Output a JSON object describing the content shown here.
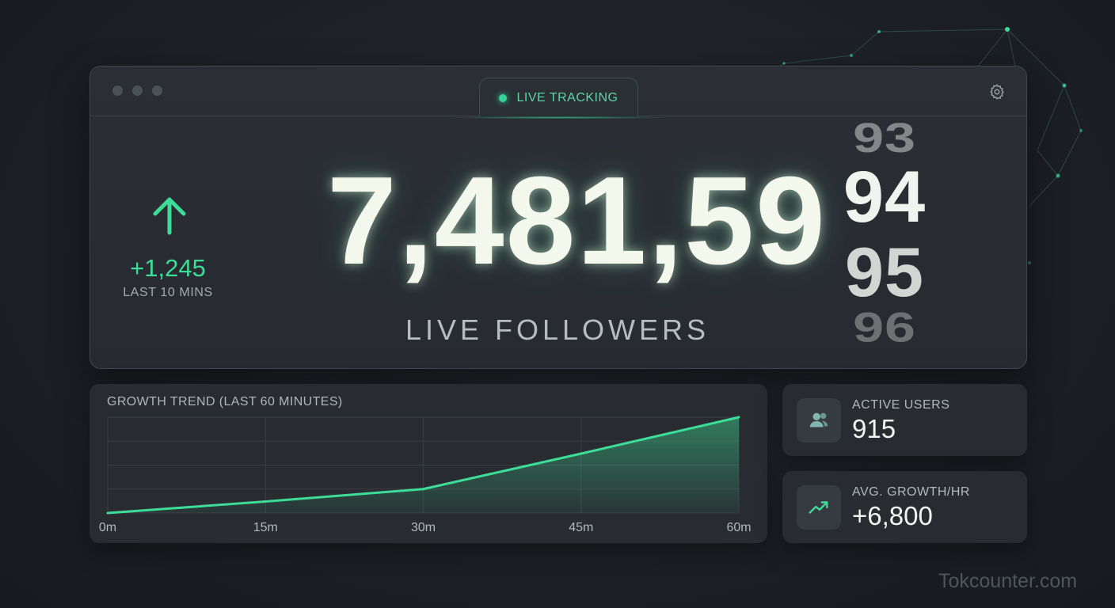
{
  "window": {
    "live_badge": "LIVE TRACKING",
    "count_main": "7,481,59",
    "odometer_digits": [
      "93",
      "94",
      "95",
      "96"
    ],
    "delta_value": "+1,245",
    "delta_label": "LAST 10 MINS",
    "followers_label": "LIVE FOLLOWERS"
  },
  "growth": {
    "title": "GROWTH TREND (LAST 60 MINUTES)"
  },
  "chart_data": {
    "type": "area",
    "title": "GROWTH TREND (LAST 60 MINUTES)",
    "x": [
      0,
      15,
      30,
      45,
      60
    ],
    "x_tick_labels": [
      "0m",
      "15m",
      "30m",
      "45m",
      "60m"
    ],
    "series": [
      {
        "values": [
          0,
          12,
          25,
          62,
          100
        ]
      }
    ],
    "ylim": [
      0,
      100
    ],
    "grid": true,
    "line_color": "#3ddc97"
  },
  "stats": [
    {
      "label": "ACTIVE USERS",
      "value": "915",
      "icon": "users-icon"
    },
    {
      "label": "AVG. GROWTH/HR",
      "value": "+6,800",
      "icon": "trending-up-icon"
    }
  ],
  "watermark": "Tokcounter.com",
  "colors": {
    "accent": "#3ddc97",
    "background": "#1e2126",
    "panel": "#282c31"
  }
}
